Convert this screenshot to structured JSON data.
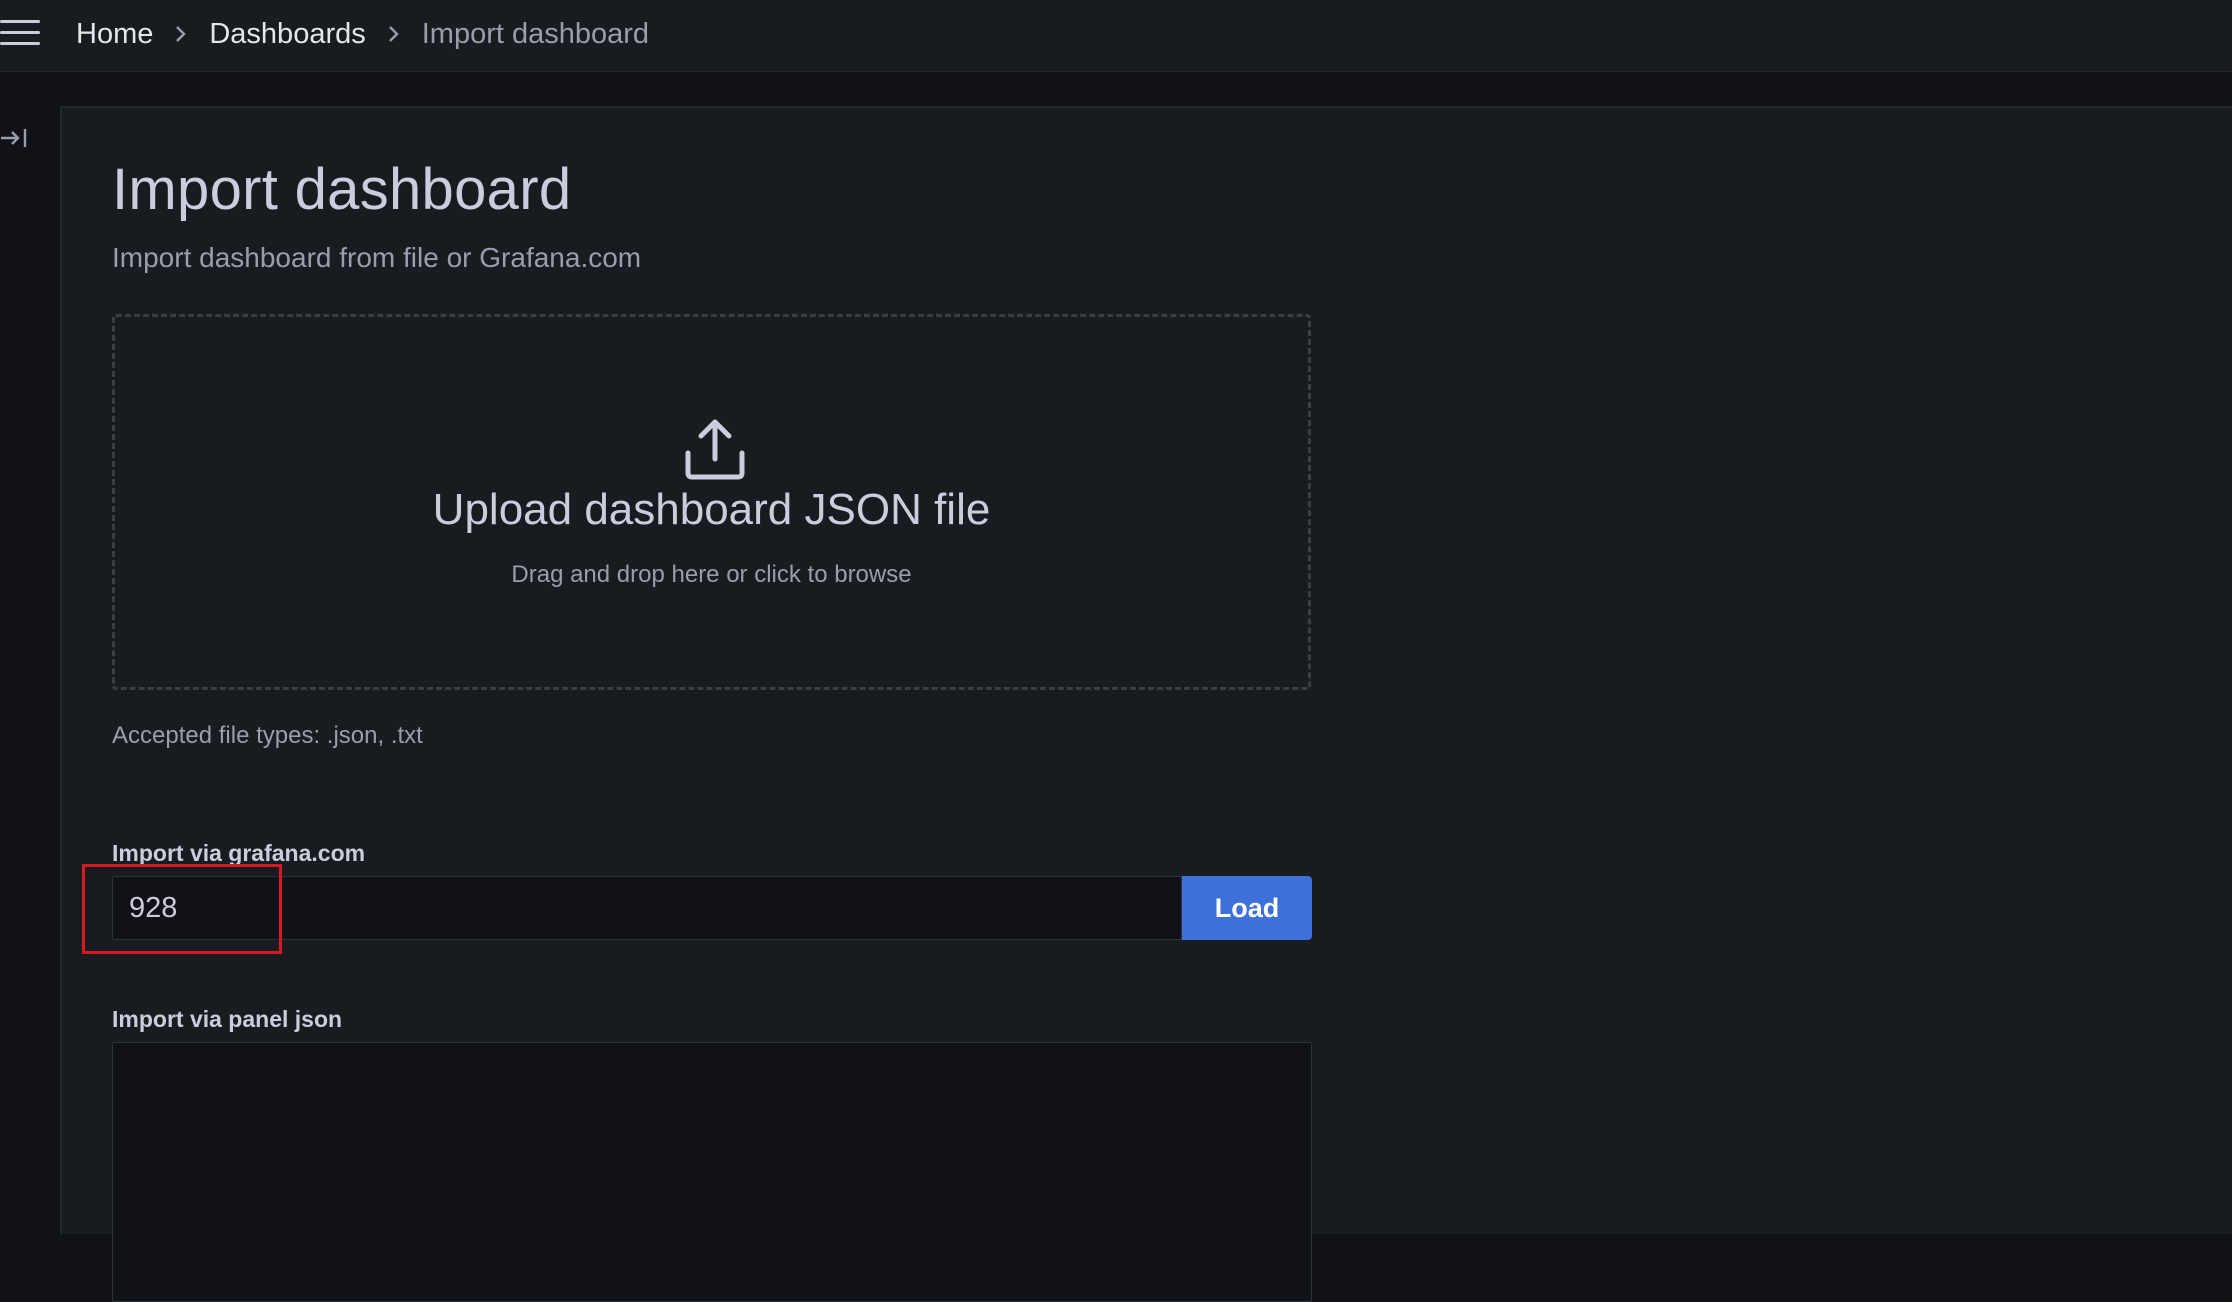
{
  "header": {
    "menu_icon": "hamburger-menu-icon",
    "breadcrumbs": [
      "Home",
      "Dashboards",
      "Import dashboard"
    ],
    "separator_icon": "chevron-right-icon"
  },
  "sidebar": {
    "dock_icon": "dock-menu-icon"
  },
  "page": {
    "title": "Import dashboard",
    "subtitle": "Import dashboard from file or Grafana.com"
  },
  "upload": {
    "icon": "upload-icon",
    "title": "Upload dashboard JSON file",
    "hint": "Drag and drop here or click to browse",
    "accepted": "Accepted file types: .json, .txt"
  },
  "grafana_com": {
    "label": "Import via grafana.com",
    "value": "928",
    "button_label": "Load",
    "button_color": "#3d71d9"
  },
  "panel_json": {
    "label": "Import via panel json",
    "value": ""
  },
  "colors": {
    "highlight": "#d9181f",
    "background": "#111217",
    "panel": "#181b1f"
  }
}
